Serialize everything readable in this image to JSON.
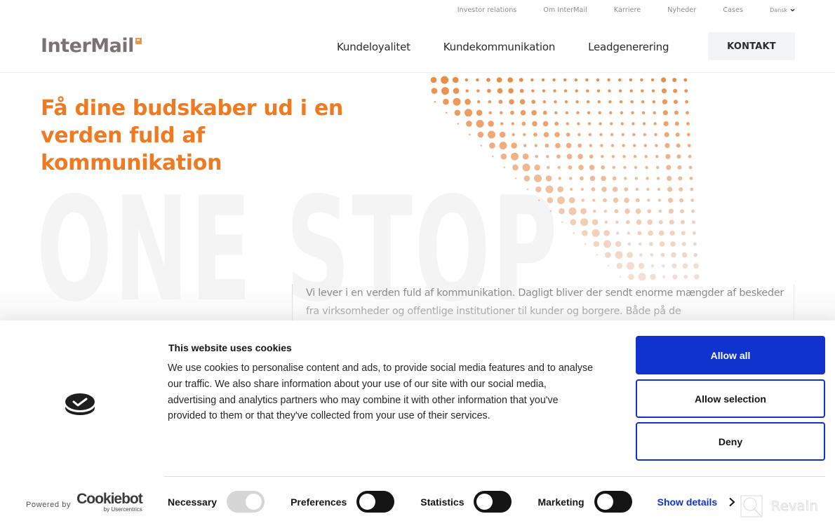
{
  "header": {
    "logo": "InterMail",
    "top_links": [
      "Investor relations",
      "Om InterMail",
      "Karriere",
      "Nyheder",
      "Cases"
    ],
    "language": "Dansk",
    "main_nav": [
      "Kundeloyalitet",
      "Kundekommunikation",
      "Leadgenerering"
    ],
    "contact_button": "KONTAKT"
  },
  "hero": {
    "headline": "Få dine budskaber ud i en verden fuld af kommunikation",
    "watermark": "ONE STOP",
    "intro": "Vi lever i en verden fuld af kommunikation. Dagligt bliver der sendt enorme mængder af beskeder fra virksomheder og offentlige institutioner til kunder og borgere. Både på de",
    "accent_color": "#ef7a22"
  },
  "cookie_banner": {
    "title": "This website uses cookies",
    "body": "We use cookies to personalise content and ads, to provide social media features and to analyse our traffic. We also share information about your use of our site with our social media, advertising and analytics partners who may combine it with other information that you've provided to them or that they've collected from your use of their services.",
    "buttons": {
      "allow_all": "Allow all",
      "allow_selection": "Allow selection",
      "deny": "Deny"
    },
    "toggles": [
      {
        "label": "Necessary",
        "state": "on-disabled"
      },
      {
        "label": "Preferences",
        "state": "off"
      },
      {
        "label": "Statistics",
        "state": "off"
      },
      {
        "label": "Marketing",
        "state": "off"
      }
    ],
    "show_details": "Show details",
    "powered_by": "Powered by",
    "provider": "Cookiebot",
    "provider_sub": "by Usercentrics",
    "brand_color": "#1032cf"
  },
  "overlay": {
    "watermark_text": "Revain"
  }
}
